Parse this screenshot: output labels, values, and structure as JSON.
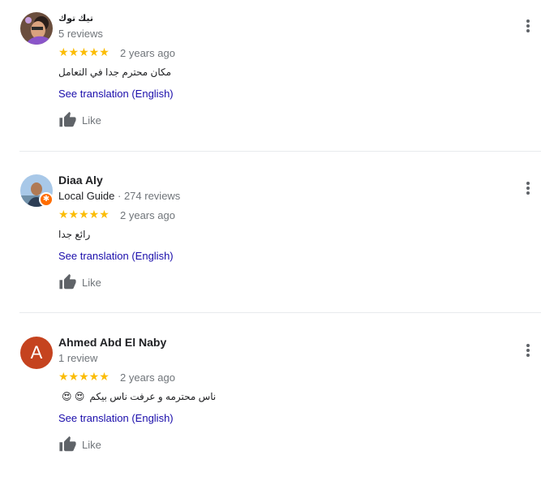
{
  "reviews": [
    {
      "name": "تيك توك",
      "meta": "5 reviews",
      "stars": "★★★★★",
      "date": "2 years ago",
      "text": "مكان محترم جدا في التعامل",
      "translate": "See translation (English)",
      "like": "Like",
      "avatar_type": "photo"
    },
    {
      "name": "Diaa Aly",
      "guide": "Local Guide",
      "meta": " · 274 reviews",
      "stars": "★★★★★",
      "date": "2 years ago",
      "text": "رائع جدا",
      "translate": "See translation (English)",
      "like": "Like",
      "avatar_type": "photo",
      "badge": "✱"
    },
    {
      "name": "Ahmed Abd El Naby",
      "meta": "1 review",
      "stars": "★★★★★",
      "date": "2 years ago",
      "text": "ناس محترمه و عرفت ناس بيكم",
      "emoji": "😍 😍",
      "translate": "See translation (English)",
      "like": "Like",
      "avatar_letter": "A",
      "avatar_color": "#c5431f"
    }
  ],
  "icons": {
    "menu": "more-vert-icon",
    "like": "thumb-up-icon",
    "star": "star-icon"
  }
}
